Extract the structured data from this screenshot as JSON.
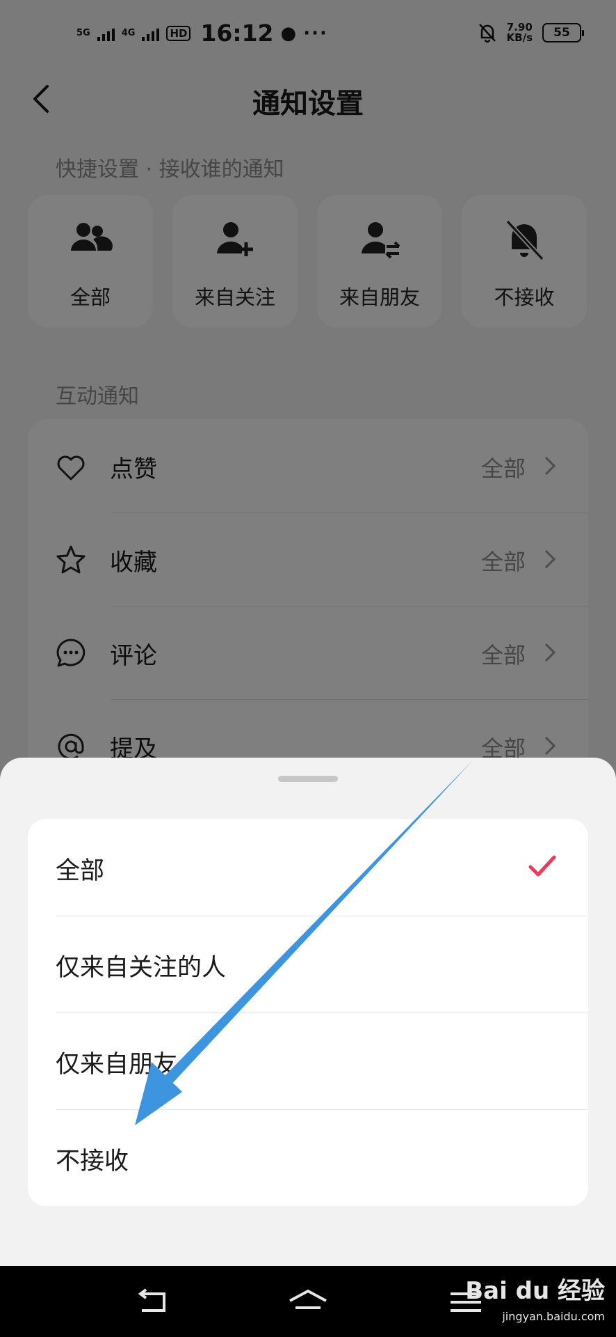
{
  "status_bar": {
    "net1": "5G",
    "net2": "4G",
    "hd": "HD",
    "time": "16:12",
    "speed_value": "7.90",
    "speed_unit": "KB/s",
    "battery": "55"
  },
  "header": {
    "title": "通知设置"
  },
  "quick": {
    "label": "快捷设置 · 接收谁的通知",
    "items": [
      {
        "label": "全部",
        "icon": "users-icon"
      },
      {
        "label": "来自关注",
        "icon": "user-add-icon"
      },
      {
        "label": "来自朋友",
        "icon": "user-swap-icon"
      },
      {
        "label": "不接收",
        "icon": "bell-off-icon"
      }
    ]
  },
  "interaction": {
    "label": "互动通知",
    "rows": [
      {
        "title": "点赞",
        "value": "全部",
        "icon": "heart-icon"
      },
      {
        "title": "收藏",
        "value": "全部",
        "icon": "star-icon"
      },
      {
        "title": "评论",
        "value": "全部",
        "icon": "comment-icon"
      },
      {
        "title": "提及",
        "value": "全部",
        "icon": "at-icon"
      }
    ]
  },
  "sheet": {
    "options": [
      {
        "label": "全部",
        "selected": true
      },
      {
        "label": "仅来自关注的人",
        "selected": false
      },
      {
        "label": "仅来自朋友",
        "selected": false
      },
      {
        "label": "不接收",
        "selected": false
      }
    ],
    "check_color": "#f0395a"
  },
  "annotation": {
    "arrow_color": "#3d95e0"
  },
  "watermark": {
    "logo": "Bai du 经验",
    "url": "jingyan.baidu.com"
  }
}
